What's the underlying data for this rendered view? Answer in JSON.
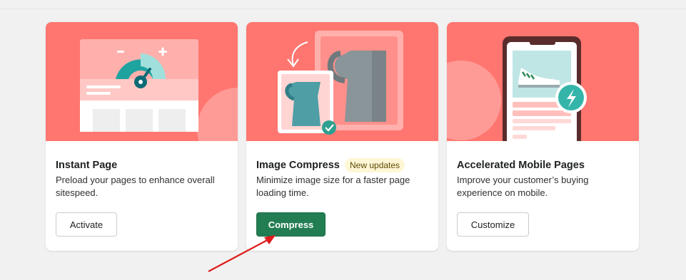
{
  "cards": [
    {
      "title": "Instant Page",
      "description": "Preload your pages to enhance overall sitespeed.",
      "button_label": "Activate",
      "illustration": "speedometer-page-illustration"
    },
    {
      "title": "Image Compress",
      "badge": "New updates",
      "description": "Minimize image size for a faster page loading time.",
      "button_label": "Compress",
      "illustration": "pitcher-compress-illustration"
    },
    {
      "title": "Accelerated Mobile Pages",
      "description": "Improve your customer’s buying experience on mobile.",
      "button_label": "Customize",
      "illustration": "mobile-shoe-illustration"
    }
  ],
  "colors": {
    "hero_background": "#ff7670",
    "primary_button": "#237d53",
    "badge_background": "#fff6d6",
    "annotation_arrow": "#e01b1b"
  }
}
